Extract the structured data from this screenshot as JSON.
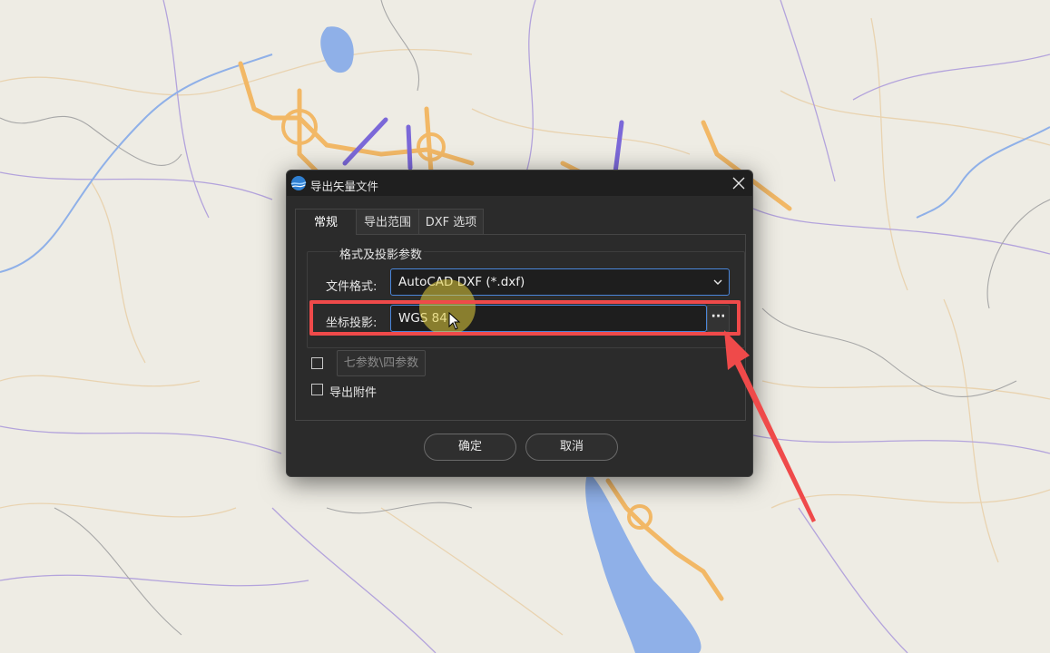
{
  "dialog": {
    "title": "导出矢量文件",
    "tabs": [
      {
        "label": "常规",
        "active": true
      },
      {
        "label": "导出范围",
        "active": false
      },
      {
        "label": "DXF 选项",
        "active": false
      }
    ],
    "group_title": "格式及投影参数",
    "file_format": {
      "label": "文件格式:",
      "value": "AutoCAD DXF (*.dxf)"
    },
    "projection": {
      "label": "坐标投影:",
      "value": "WGS 84",
      "browse_label": "···"
    },
    "seven_param": {
      "checked": false,
      "button_label": "七参数\\四参数"
    },
    "export_attachment": {
      "checked": false,
      "label": "导出附件"
    },
    "ok_label": "确定",
    "cancel_label": "取消"
  },
  "colors": {
    "map_background": "#eeece4",
    "highway": "#f2b866",
    "expressway": "#7b68d8",
    "water": "#8fb0e8",
    "dialog_bg": "#2b2b2b",
    "accent_border": "#4a86d9",
    "annotation_red": "#ef4a4a"
  }
}
